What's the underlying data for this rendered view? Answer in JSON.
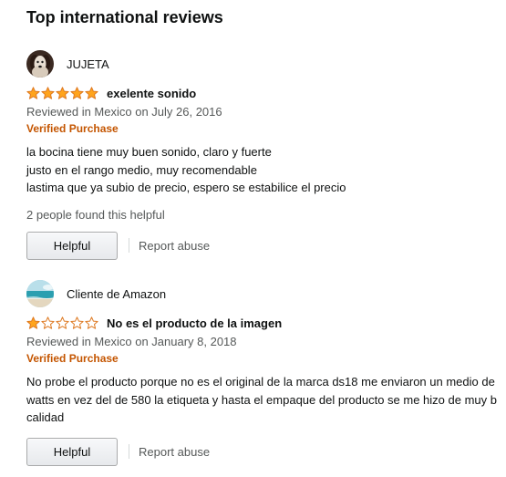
{
  "section": {
    "title": "Top international reviews"
  },
  "colors": {
    "star_fill": "#ffa41c",
    "star_outline": "#de7921",
    "verified": "#c45500",
    "muted_text": "#565959"
  },
  "reviews": [
    {
      "profile_name": "JUJETA",
      "avatar_icon": "dog-photo-avatar",
      "rating": 5,
      "rating_max": 5,
      "title": "exelente sonido",
      "date": "Reviewed in Mexico on July 26, 2016",
      "verified_label": "Verified Purchase",
      "body_lines": [
        "la bocina tiene muy buen sonido, claro y fuerte",
        "justo en el rango medio, muy recomendable",
        "lastima que ya subio de precio, espero se estabilice el precio"
      ],
      "helpful_count_text": "2 people found this helpful",
      "helpful_label": "Helpful",
      "report_label": "Report abuse"
    },
    {
      "profile_name": "Cliente de Amazon",
      "avatar_icon": "beach-photo-avatar",
      "rating": 1,
      "rating_max": 5,
      "title": "No es el producto de la imagen",
      "date": "Reviewed in Mexico on January 8, 2018",
      "verified_label": "Verified Purchase",
      "body_lines": [
        "No probe el producto porque no es el original de la marca ds18 me enviaron un medio de",
        "watts en vez del de 580 la etiqueta y hasta el empaque del producto se me hizo de muy b",
        "calidad"
      ],
      "helpful_label": "Helpful",
      "report_label": "Report abuse"
    }
  ]
}
